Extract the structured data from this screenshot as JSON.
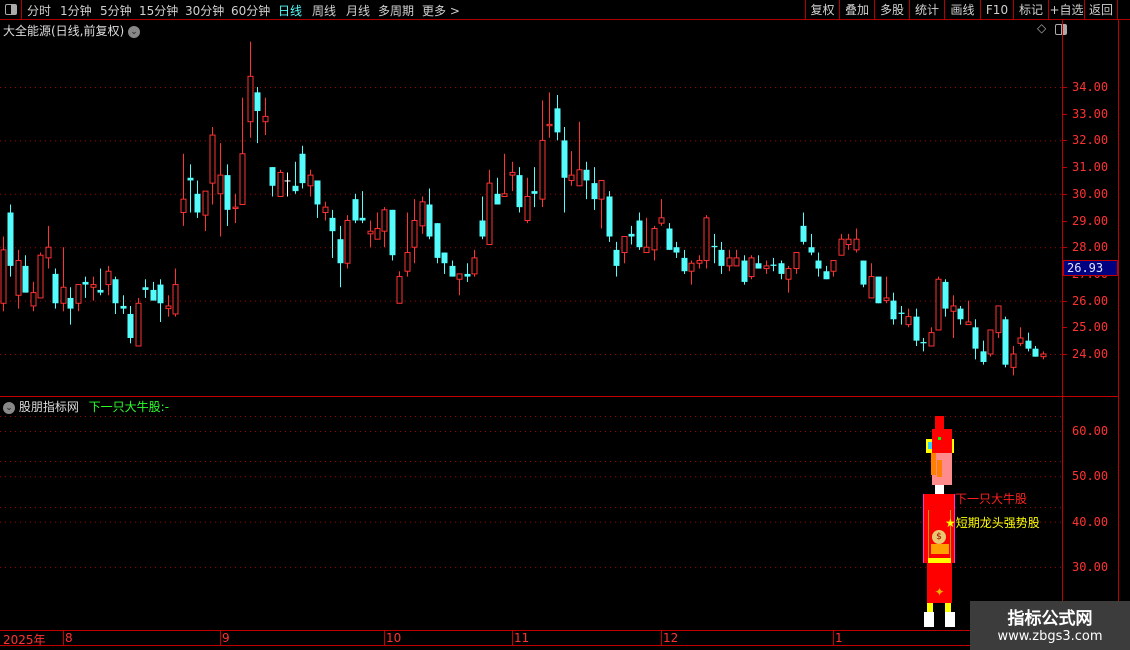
{
  "toolbar": {
    "periods": [
      "分时",
      "1分钟",
      "5分钟",
      "15分钟",
      "30分钟",
      "60分钟",
      "日线",
      "周线",
      "月线",
      "多周期",
      "更多 >"
    ],
    "active_period": "日线",
    "right_buttons": [
      "复权",
      "叠加",
      "多股",
      "统计",
      "画线",
      "F10",
      "标记",
      "+自选",
      "返回"
    ]
  },
  "main_chart": {
    "title": "大全能源(日线,前复权)",
    "current_price": "26.93"
  },
  "indicator": {
    "name": "股朋指标网",
    "param_label": "下一只大牛股:-",
    "signal_label_1": "下一只大牛股",
    "signal_label_2": "★短期龙头强势股",
    "yticks": [
      "60.00",
      "50.00",
      "40.00",
      "30.00"
    ]
  },
  "xaxis": {
    "year_label": "2025年",
    "months": [
      {
        "label": "8",
        "index": 8
      },
      {
        "label": "9",
        "index": 29
      },
      {
        "label": "10",
        "index": 51
      },
      {
        "label": "11",
        "index": 68
      },
      {
        "label": "12",
        "index": 88
      },
      {
        "label": "1",
        "index": 111
      }
    ]
  },
  "watermark": {
    "title": "指标公式网",
    "url": "www.zbgs3.com"
  },
  "colors": {
    "up": "#ff3232",
    "down": "#54fcfc",
    "grid": "#a00000",
    "axis": "#ff3232",
    "price_box": "#000080"
  },
  "chart_data": {
    "type": "candlestick",
    "ylim": [
      23,
      36
    ],
    "yticks": [
      "34.00",
      "33.00",
      "32.00",
      "31.00",
      "30.00",
      "29.00",
      "28.00",
      "27.00",
      "26.00",
      "25.00",
      "24.00"
    ],
    "grid": true,
    "ohlc": [
      [
        25.9,
        27.9,
        28.4,
        25.6
      ],
      [
        29.3,
        27.3,
        29.6,
        26.9
      ],
      [
        26.2,
        27.5,
        27.9,
        25.7
      ],
      [
        27.3,
        26.3,
        27.7,
        26.3
      ],
      [
        25.8,
        26.3,
        26.7,
        25.6
      ],
      [
        26.1,
        27.7,
        27.8,
        26.1
      ],
      [
        27.6,
        28.0,
        28.8,
        27.2
      ],
      [
        27.0,
        25.9,
        27.2,
        25.7
      ],
      [
        25.9,
        26.5,
        28.0,
        25.6
      ],
      [
        26.1,
        25.7,
        26.5,
        25.1
      ],
      [
        25.9,
        26.6,
        26.6,
        25.6
      ],
      [
        26.7,
        26.6,
        26.9,
        26.1
      ],
      [
        26.5,
        26.6,
        26.9,
        26.0
      ],
      [
        26.4,
        26.3,
        27.2,
        26.2
      ],
      [
        26.6,
        27.1,
        27.3,
        26.2
      ],
      [
        26.8,
        25.9,
        26.9,
        25.5
      ],
      [
        25.8,
        25.7,
        26.2,
        25.5
      ],
      [
        25.5,
        24.6,
        25.8,
        24.4
      ],
      [
        24.3,
        25.9,
        26.1,
        24.3
      ],
      [
        26.5,
        26.4,
        26.8,
        26.1
      ],
      [
        26.4,
        26.0,
        26.7,
        26.0
      ],
      [
        26.6,
        25.9,
        26.8,
        25.2
      ],
      [
        25.7,
        25.8,
        26.2,
        25.4
      ],
      [
        25.5,
        26.6,
        27.2,
        25.4
      ],
      [
        29.3,
        29.8,
        31.5,
        28.8
      ],
      [
        30.6,
        30.5,
        31.1,
        29.3
      ],
      [
        30.0,
        29.3,
        30.5,
        29.1
      ],
      [
        29.2,
        30.1,
        30.1,
        28.6
      ],
      [
        30.4,
        32.2,
        32.5,
        29.6
      ],
      [
        30.0,
        30.7,
        31.9,
        28.4
      ],
      [
        30.7,
        29.4,
        31.1,
        28.8
      ],
      [
        29.45,
        29.5,
        30.0,
        28.9
      ],
      [
        29.6,
        31.5,
        33.6,
        29.6
      ],
      [
        32.7,
        34.4,
        35.7,
        32.1
      ],
      [
        33.8,
        33.1,
        34.0,
        31.9
      ],
      [
        32.7,
        32.9,
        33.6,
        32.2
      ],
      [
        31.0,
        30.3,
        31.0,
        29.9
      ],
      [
        29.9,
        30.8,
        30.9,
        29.9
      ],
      [
        30.5,
        30.5,
        30.8,
        29.9
      ],
      [
        30.3,
        30.1,
        31.2,
        30.0
      ],
      [
        31.5,
        30.4,
        31.8,
        30.2
      ],
      [
        30.3,
        30.7,
        30.9,
        29.9
      ],
      [
        30.5,
        29.6,
        30.5,
        29.1
      ],
      [
        29.3,
        29.5,
        29.7,
        29.0
      ],
      [
        29.1,
        28.6,
        29.4,
        27.6
      ],
      [
        28.3,
        27.4,
        28.8,
        26.5
      ],
      [
        27.4,
        29.0,
        29.2,
        27.2
      ],
      [
        29.8,
        29.0,
        30.0,
        28.9
      ],
      [
        29.1,
        29.0,
        30.1,
        28.9
      ],
      [
        28.5,
        28.6,
        29.0,
        28.0
      ],
      [
        28.3,
        28.7,
        29.3,
        28.3
      ],
      [
        28.6,
        29.4,
        29.5,
        28.0
      ],
      [
        29.4,
        27.7,
        29.4,
        27.5
      ],
      [
        25.9,
        26.9,
        27.1,
        25.9
      ],
      [
        27.1,
        27.8,
        29.3,
        26.9
      ],
      [
        28.0,
        29.0,
        29.8,
        27.4
      ],
      [
        28.8,
        29.7,
        29.9,
        28.5
      ],
      [
        29.6,
        28.4,
        30.2,
        28.3
      ],
      [
        28.9,
        27.6,
        28.9,
        27.4
      ],
      [
        27.8,
        27.4,
        27.8,
        27.0
      ],
      [
        27.3,
        26.9,
        27.5,
        26.9
      ],
      [
        26.8,
        27.0,
        27.0,
        26.2
      ],
      [
        27.0,
        26.9,
        27.4,
        26.7
      ],
      [
        27.0,
        27.6,
        27.9,
        26.9
      ],
      [
        29.0,
        28.4,
        29.9,
        28.3
      ],
      [
        28.1,
        30.4,
        30.9,
        28.1
      ],
      [
        30.0,
        29.6,
        30.6,
        29.6
      ],
      [
        29.9,
        30.0,
        31.5,
        29.9
      ],
      [
        30.7,
        30.8,
        31.2,
        30.1
      ],
      [
        30.7,
        29.5,
        31.0,
        29.3
      ],
      [
        29.0,
        29.9,
        30.6,
        28.9
      ],
      [
        30.1,
        30.0,
        31.0,
        29.5
      ],
      [
        29.8,
        32.0,
        33.5,
        29.5
      ],
      [
        32.55,
        32.6,
        33.8,
        32.1
      ],
      [
        33.2,
        32.3,
        33.7,
        32.0
      ],
      [
        32.0,
        30.6,
        32.5,
        29.3
      ],
      [
        30.5,
        30.7,
        31.6,
        30.3
      ],
      [
        30.3,
        30.9,
        32.7,
        30.3
      ],
      [
        30.9,
        30.5,
        31.2,
        29.8
      ],
      [
        30.4,
        29.8,
        31.0,
        29.4
      ],
      [
        29.8,
        30.5,
        30.5,
        28.7
      ],
      [
        29.9,
        28.4,
        30.1,
        28.2
      ],
      [
        27.9,
        27.3,
        28.2,
        26.9
      ],
      [
        27.8,
        28.4,
        28.4,
        27.4
      ],
      [
        28.5,
        28.4,
        28.8,
        28.1
      ],
      [
        29.0,
        28.0,
        29.3,
        27.9
      ],
      [
        27.8,
        28.0,
        29.1,
        27.8
      ],
      [
        27.9,
        28.7,
        28.8,
        27.5
      ],
      [
        28.9,
        29.1,
        29.8,
        28.8
      ],
      [
        28.7,
        27.9,
        28.9,
        27.9
      ],
      [
        28.0,
        27.8,
        28.2,
        27.6
      ],
      [
        27.6,
        27.1,
        27.9,
        27.0
      ],
      [
        27.1,
        27.4,
        27.5,
        26.6
      ],
      [
        27.4,
        27.5,
        27.7,
        27.2
      ],
      [
        27.5,
        29.1,
        29.2,
        27.2
      ],
      [
        28.05,
        28.0,
        28.5,
        27.4
      ],
      [
        27.9,
        27.3,
        28.2,
        27.0
      ],
      [
        27.3,
        27.6,
        27.9,
        27.1
      ],
      [
        27.3,
        27.6,
        27.9,
        27.3
      ],
      [
        27.5,
        26.7,
        27.7,
        26.6
      ],
      [
        26.9,
        27.6,
        27.7,
        26.8
      ],
      [
        27.4,
        27.2,
        27.7,
        27.2
      ],
      [
        27.2,
        27.3,
        27.5,
        27.0
      ],
      [
        27.35,
        27.3,
        27.6,
        27.1
      ],
      [
        27.4,
        27.0,
        27.5,
        26.8
      ],
      [
        26.8,
        27.2,
        27.3,
        26.3
      ],
      [
        27.2,
        27.8,
        27.8,
        27.0
      ],
      [
        28.8,
        28.2,
        29.3,
        28.1
      ],
      [
        28.0,
        27.8,
        28.5,
        27.7
      ],
      [
        27.5,
        27.2,
        27.8,
        26.9
      ],
      [
        27.1,
        26.8,
        27.3,
        26.8
      ],
      [
        27.1,
        27.5,
        27.5,
        26.9
      ],
      [
        27.7,
        28.3,
        28.5,
        27.7
      ],
      [
        28.1,
        28.3,
        28.5,
        27.9
      ],
      [
        27.9,
        28.3,
        28.7,
        27.8
      ],
      [
        27.5,
        26.6,
        27.5,
        26.5
      ],
      [
        26.1,
        26.9,
        27.4,
        26.1
      ],
      [
        26.9,
        25.9,
        26.9,
        25.9
      ],
      [
        26.0,
        26.1,
        26.9,
        25.9
      ],
      [
        26.0,
        25.3,
        26.3,
        25.1
      ],
      [
        25.55,
        25.5,
        25.8,
        25.1
      ],
      [
        25.1,
        25.4,
        25.7,
        25.0
      ],
      [
        25.4,
        24.5,
        25.7,
        24.3
      ],
      [
        24.45,
        24.4,
        24.6,
        24.1
      ],
      [
        24.3,
        24.8,
        25.0,
        24.3
      ],
      [
        24.9,
        26.8,
        26.9,
        24.9
      ],
      [
        26.7,
        25.7,
        26.8,
        25.4
      ],
      [
        25.6,
        25.8,
        26.2,
        24.6
      ],
      [
        25.7,
        25.3,
        25.8,
        25.1
      ],
      [
        25.1,
        25.2,
        26.0,
        25.1
      ],
      [
        25.0,
        24.2,
        25.3,
        23.8
      ],
      [
        24.1,
        23.7,
        24.5,
        23.6
      ],
      [
        24.0,
        24.9,
        24.9,
        23.9
      ],
      [
        24.8,
        25.8,
        25.8,
        24.6
      ],
      [
        25.3,
        23.6,
        25.4,
        23.5
      ],
      [
        23.5,
        24.0,
        24.3,
        23.2
      ],
      [
        24.4,
        24.6,
        25.0,
        24.3
      ],
      [
        24.5,
        24.2,
        24.8,
        24.1
      ],
      [
        24.2,
        23.9,
        24.3,
        23.9
      ],
      [
        23.9,
        24.0,
        24.1,
        23.8
      ]
    ]
  }
}
